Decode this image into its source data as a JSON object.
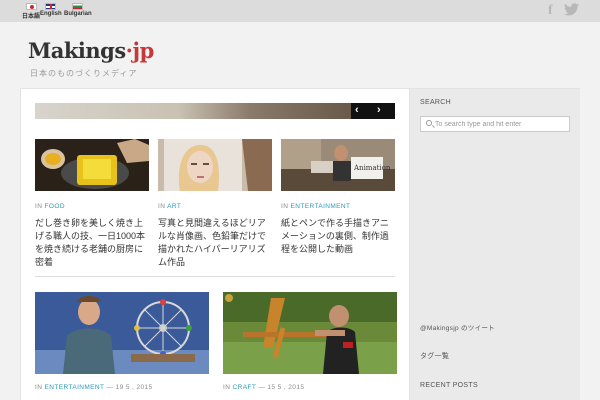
{
  "languages": [
    {
      "label": "日本語",
      "icon": "flag-jp-icon"
    },
    {
      "label": "English",
      "icon": "flag-en-icon"
    },
    {
      "label": "Bulgarian",
      "icon": "flag-bg-icon"
    }
  ],
  "social": {
    "facebook_icon": "f",
    "twitter_icon": "✦"
  },
  "site": {
    "logo_main": "Makings",
    "logo_dot": "·",
    "logo_accent": "jp",
    "tagline": "日本のものづくりメディア"
  },
  "slider": {
    "prev": "‹",
    "next": "›"
  },
  "posts_row1": [
    {
      "cat_prefix": "IN",
      "category": "FOOD",
      "title": "だし巻き卵を美しく焼き上げる職人の技、一日1000本を焼き続ける老舗の厨房に密着"
    },
    {
      "cat_prefix": "IN",
      "category": "ART",
      "title": "写真と見間違えるほどリアルな肖像画、色鉛筆だけで描かれたハイパーリアリズム作品"
    },
    {
      "cat_prefix": "IN",
      "category": "ENTERTAINMENT",
      "title": "紙とペンで作る手描きアニメーションの裏側、制作過程を公開した動画"
    }
  ],
  "posts_row2": [
    {
      "cat_prefix": "IN",
      "category": "ENTERTAINMENT",
      "date": "— 19 5 , 2015"
    },
    {
      "cat_prefix": "IN",
      "category": "CRAFT",
      "date": "— 15 5 , 2015"
    }
  ],
  "sidebar": {
    "search_heading": "SEARCH",
    "search_placeholder": "To search type and hit enter",
    "twitter_heading": "@Makingsjp のツイート",
    "tags_heading": "タグ一覧",
    "recent_heading": "RECENT POSTS"
  },
  "colors": {
    "accent": "#c23a3a",
    "category": "#2a9bb8"
  }
}
